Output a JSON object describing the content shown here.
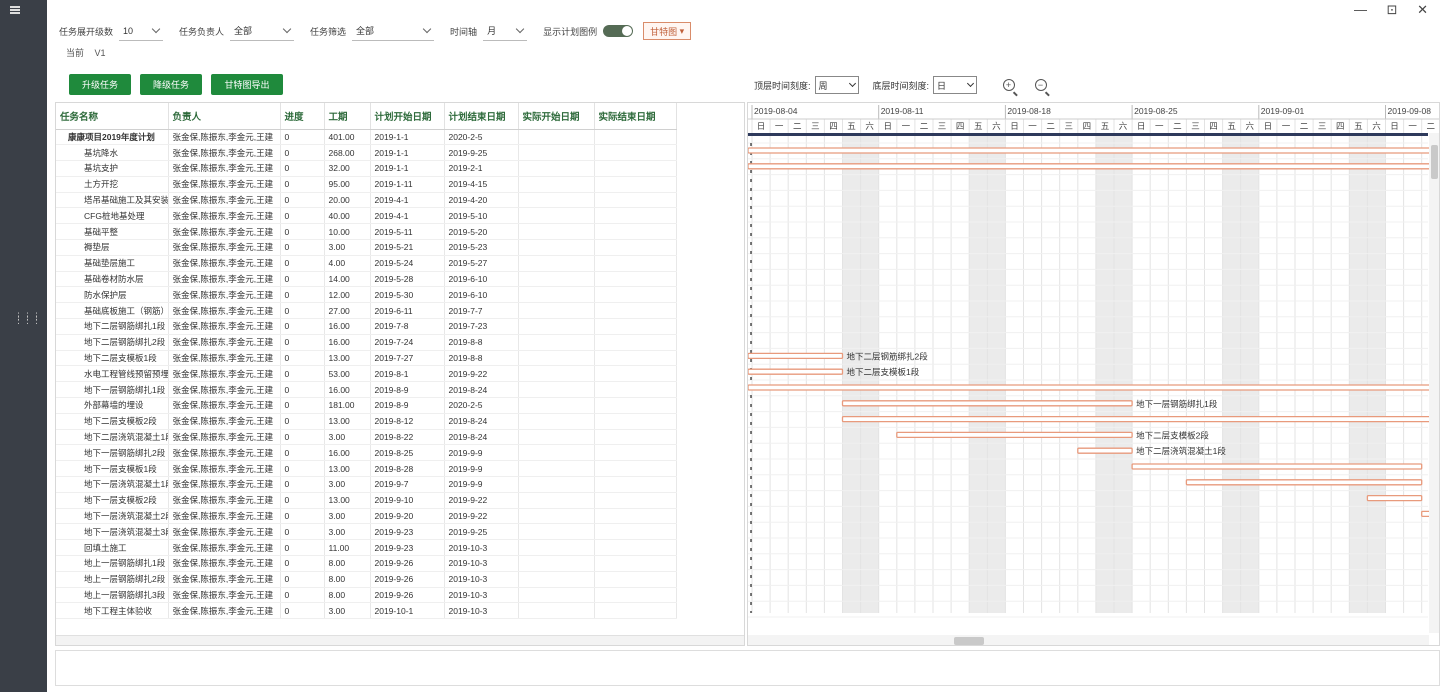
{
  "window": {
    "controls": "— ⊡ ✕"
  },
  "filters": {
    "expand_label": "任务展开级数",
    "expand_value": "10",
    "owner_label": "任务负责人",
    "owner_value": "全部",
    "filter_label": "任务筛选",
    "filter_value": "全部",
    "axis_label": "时间轴",
    "axis_value": "月",
    "show_plan_label": "显示计划图例",
    "gantt_button": "甘特图"
  },
  "breadcrumb": {
    "home": "当前",
    "version": "V1"
  },
  "toolbar": {
    "upgrade": "升级任务",
    "downgrade": "降级任务",
    "export": "甘特图导出"
  },
  "zoom": {
    "top_label": "顶层时间刻度:",
    "top_value": "周",
    "bottom_label": "底层时间刻度:",
    "bottom_value": "日"
  },
  "table": {
    "headers": [
      "任务名称",
      "负责人",
      "进度",
      "工期",
      "计划开始日期",
      "计划结束日期",
      "实际开始日期",
      "实际结束日期"
    ],
    "rows": [
      [
        "康康项目2019年度计划",
        "张金保,陈振东,李金元,王建",
        "0",
        "401.00",
        "2019-1-1",
        "2020-2-5",
        "",
        ""
      ],
      [
        "基坑降水",
        "张金保,陈振东,李金元,王建",
        "0",
        "268.00",
        "2019-1-1",
        "2019-9-25",
        "",
        ""
      ],
      [
        "基坑支护",
        "张金保,陈振东,李金元,王建",
        "0",
        "32.00",
        "2019-1-1",
        "2019-2-1",
        "",
        ""
      ],
      [
        "土方开挖",
        "张金保,陈振东,李金元,王建",
        "0",
        "95.00",
        "2019-1-11",
        "2019-4-15",
        "",
        ""
      ],
      [
        "塔吊基础施工及其安装",
        "张金保,陈振东,李金元,王建",
        "0",
        "20.00",
        "2019-4-1",
        "2019-4-20",
        "",
        ""
      ],
      [
        "CFG桩地基处理",
        "张金保,陈振东,李金元,王建",
        "0",
        "40.00",
        "2019-4-1",
        "2019-5-10",
        "",
        ""
      ],
      [
        "基础平整",
        "张金保,陈振东,李金元,王建",
        "0",
        "10.00",
        "2019-5-11",
        "2019-5-20",
        "",
        ""
      ],
      [
        "褥垫层",
        "张金保,陈振东,李金元,王建",
        "0",
        "3.00",
        "2019-5-21",
        "2019-5-23",
        "",
        ""
      ],
      [
        "基础垫层施工",
        "张金保,陈振东,李金元,王建",
        "0",
        "4.00",
        "2019-5-24",
        "2019-5-27",
        "",
        ""
      ],
      [
        "基础卷材防水层",
        "张金保,陈振东,李金元,王建",
        "0",
        "14.00",
        "2019-5-28",
        "2019-6-10",
        "",
        ""
      ],
      [
        "防水保护层",
        "张金保,陈振东,李金元,王建",
        "0",
        "12.00",
        "2019-5-30",
        "2019-6-10",
        "",
        ""
      ],
      [
        "基础底板施工（钢筋）",
        "张金保,陈振东,李金元,王建",
        "0",
        "27.00",
        "2019-6-11",
        "2019-7-7",
        "",
        ""
      ],
      [
        "地下二层钢筋绑扎1段",
        "张金保,陈振东,李金元,王建",
        "0",
        "16.00",
        "2019-7-8",
        "2019-7-23",
        "",
        ""
      ],
      [
        "地下二层钢筋绑扎2段",
        "张金保,陈振东,李金元,王建",
        "0",
        "16.00",
        "2019-7-24",
        "2019-8-8",
        "",
        ""
      ],
      [
        "地下二层支模板1段",
        "张金保,陈振东,李金元,王建",
        "0",
        "13.00",
        "2019-7-27",
        "2019-8-8",
        "",
        ""
      ],
      [
        "水电工程管线预留预埋",
        "张金保,陈振东,李金元,王建",
        "0",
        "53.00",
        "2019-8-1",
        "2019-9-22",
        "",
        ""
      ],
      [
        "地下一层钢筋绑扎1段",
        "张金保,陈振东,李金元,王建",
        "0",
        "16.00",
        "2019-8-9",
        "2019-8-24",
        "",
        ""
      ],
      [
        "外部幕墙的埋设",
        "张金保,陈振东,李金元,王建",
        "0",
        "181.00",
        "2019-8-9",
        "2020-2-5",
        "",
        ""
      ],
      [
        "地下二层支模板2段",
        "张金保,陈振东,李金元,王建",
        "0",
        "13.00",
        "2019-8-12",
        "2019-8-24",
        "",
        ""
      ],
      [
        "地下二层浇筑混凝土1段",
        "张金保,陈振东,李金元,王建",
        "0",
        "3.00",
        "2019-8-22",
        "2019-8-24",
        "",
        ""
      ],
      [
        "地下一层钢筋绑扎2段",
        "张金保,陈振东,李金元,王建",
        "0",
        "16.00",
        "2019-8-25",
        "2019-9-9",
        "",
        ""
      ],
      [
        "地下一层支模板1段",
        "张金保,陈振东,李金元,王建",
        "0",
        "13.00",
        "2019-8-28",
        "2019-9-9",
        "",
        ""
      ],
      [
        "地下一层浇筑混凝土1段",
        "张金保,陈振东,李金元,王建",
        "0",
        "3.00",
        "2019-9-7",
        "2019-9-9",
        "",
        ""
      ],
      [
        "地下一层支模板2段",
        "张金保,陈振东,李金元,王建",
        "0",
        "13.00",
        "2019-9-10",
        "2019-9-22",
        "",
        ""
      ],
      [
        "地下一层浇筑混凝土2段",
        "张金保,陈振东,李金元,王建",
        "0",
        "3.00",
        "2019-9-20",
        "2019-9-22",
        "",
        ""
      ],
      [
        "地下一层浇筑混凝土3段",
        "张金保,陈振东,李金元,王建",
        "0",
        "3.00",
        "2019-9-23",
        "2019-9-25",
        "",
        ""
      ],
      [
        "回填土施工",
        "张金保,陈振东,李金元,王建",
        "0",
        "11.00",
        "2019-9-23",
        "2019-10-3",
        "",
        ""
      ],
      [
        "地上一层钢筋绑扎1段",
        "张金保,陈振东,李金元,王建",
        "0",
        "8.00",
        "2019-9-26",
        "2019-10-3",
        "",
        ""
      ],
      [
        "地上一层钢筋绑扎2段",
        "张金保,陈振东,李金元,王建",
        "0",
        "8.00",
        "2019-9-26",
        "2019-10-3",
        "",
        ""
      ],
      [
        "地上一层钢筋绑扎3段",
        "张金保,陈振东,李金元,王建",
        "0",
        "8.00",
        "2019-9-26",
        "2019-10-3",
        "",
        ""
      ],
      [
        "地下工程主体验收",
        "张金保,陈振东,李金元,王建",
        "0",
        "3.00",
        "2019-10-1",
        "2019-10-3",
        "",
        ""
      ]
    ]
  },
  "gantt": {
    "weeks": [
      "2019-08-04",
      "2019-08-11",
      "2019-08-18",
      "2019-08-25",
      "2019-09-01",
      "2019-09-08"
    ],
    "weekdays": [
      "日",
      "一",
      "二",
      "三",
      "四",
      "五",
      "六"
    ],
    "view_start": "2019-08-04",
    "bar_labels": {
      "13": "地下二层钢筋绑扎2段",
      "14": "地下二层支模板1段",
      "16": "地下一层钢筋绑扎1段",
      "18": "地下二层支模板2段",
      "19": "地下二层浇筑混凝土1段"
    },
    "bar_color": "#e89a7c"
  }
}
